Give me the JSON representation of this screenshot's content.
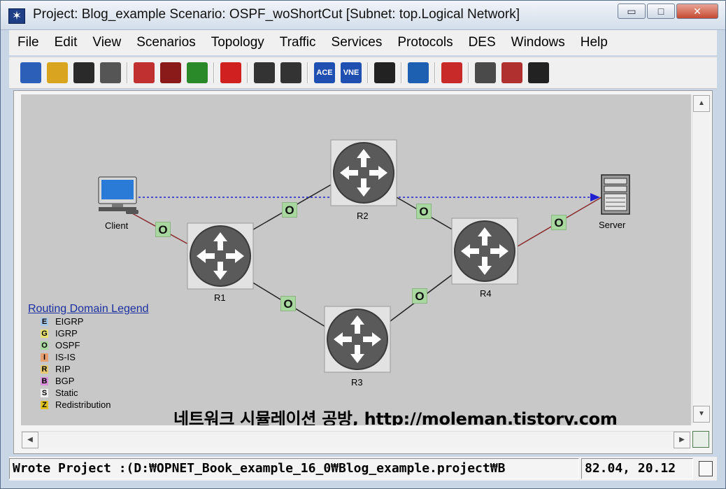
{
  "window": {
    "title": "Project: Blog_example Scenario: OSPF_woShortCut  [Subnet: top.Logical Network]",
    "controls": {
      "minimize": "▭",
      "maximize": "□",
      "close": "✕"
    }
  },
  "menu": [
    {
      "label": "File"
    },
    {
      "label": "Edit"
    },
    {
      "label": "View"
    },
    {
      "label": "Scenarios"
    },
    {
      "label": "Topology"
    },
    {
      "label": "Traffic"
    },
    {
      "label": "Services"
    },
    {
      "label": "Protocols"
    },
    {
      "label": "DES"
    },
    {
      "label": "Windows"
    },
    {
      "label": "Help"
    }
  ],
  "toolbar": {
    "buttons": [
      {
        "icon": "new-project-icon",
        "color": "#2c5fb8"
      },
      {
        "icon": "open-folder-icon",
        "color": "#d9a520"
      },
      {
        "icon": "save-icon",
        "color": "#2a2a2a"
      },
      {
        "icon": "print-icon",
        "color": "#555555"
      },
      {
        "icon": "rapid-config-icon",
        "color": "#c03030"
      },
      {
        "icon": "fail-link-icon",
        "color": "#8a1a1a"
      },
      {
        "icon": "recover-link-icon",
        "color": "#2a8a2a"
      },
      {
        "icon": "return-parent-icon",
        "color": "#d02020"
      },
      {
        "icon": "zoom-in-icon",
        "color": "#333333"
      },
      {
        "icon": "zoom-out-icon",
        "color": "#333333"
      },
      {
        "icon": "ace-import-icon",
        "color": "#1f4fb0",
        "text": "ACE"
      },
      {
        "icon": "vne-import-icon",
        "color": "#1f4fb0",
        "text": "VNE"
      },
      {
        "icon": "traffic-light-icon",
        "color": "#222222"
      },
      {
        "icon": "configure-sim-icon",
        "color": "#1d5fb0"
      },
      {
        "icon": "run-des-icon",
        "color": "#c82a2a"
      },
      {
        "icon": "view-results-icon",
        "color": "#4a4a4a"
      },
      {
        "icon": "hide-graphs-icon",
        "color": "#b03030"
      },
      {
        "icon": "log-icon",
        "color": "#222222"
      }
    ]
  },
  "topology": {
    "nodes": [
      {
        "id": "client",
        "label": "Client"
      },
      {
        "id": "r1",
        "label": "R1"
      },
      {
        "id": "r2",
        "label": "R2"
      },
      {
        "id": "r3",
        "label": "R3"
      },
      {
        "id": "r4",
        "label": "R4"
      },
      {
        "id": "server",
        "label": "Server"
      }
    ],
    "link_badges": [
      "O",
      "O",
      "O",
      "O",
      "O",
      "O"
    ]
  },
  "legend": {
    "title": "Routing Domain Legend",
    "items": [
      {
        "code": "E",
        "name": "EIGRP",
        "color": "#a8c8e8"
      },
      {
        "code": "G",
        "name": "IGRP",
        "color": "#e8e070"
      },
      {
        "code": "O",
        "name": "OSPF",
        "color": "#a8d8a0"
      },
      {
        "code": "I",
        "name": "IS-IS",
        "color": "#e8a070"
      },
      {
        "code": "R",
        "name": "RIP",
        "color": "#e8c870"
      },
      {
        "code": "B",
        "name": "BGP",
        "color": "#d890d8"
      },
      {
        "code": "S",
        "name": "Static",
        "color": "#f0f0f0"
      },
      {
        "code": "Z",
        "name": "Redistribution",
        "color": "#e0c020"
      }
    ]
  },
  "watermark": "네트워크 시뮬레이션 공방, http://moleman.tistory.com",
  "status": {
    "message": "Wrote Project :(D:₩OPNET_Book_example_16_0₩Blog_example.project₩B",
    "coordinates": "82.04, 20.12"
  }
}
